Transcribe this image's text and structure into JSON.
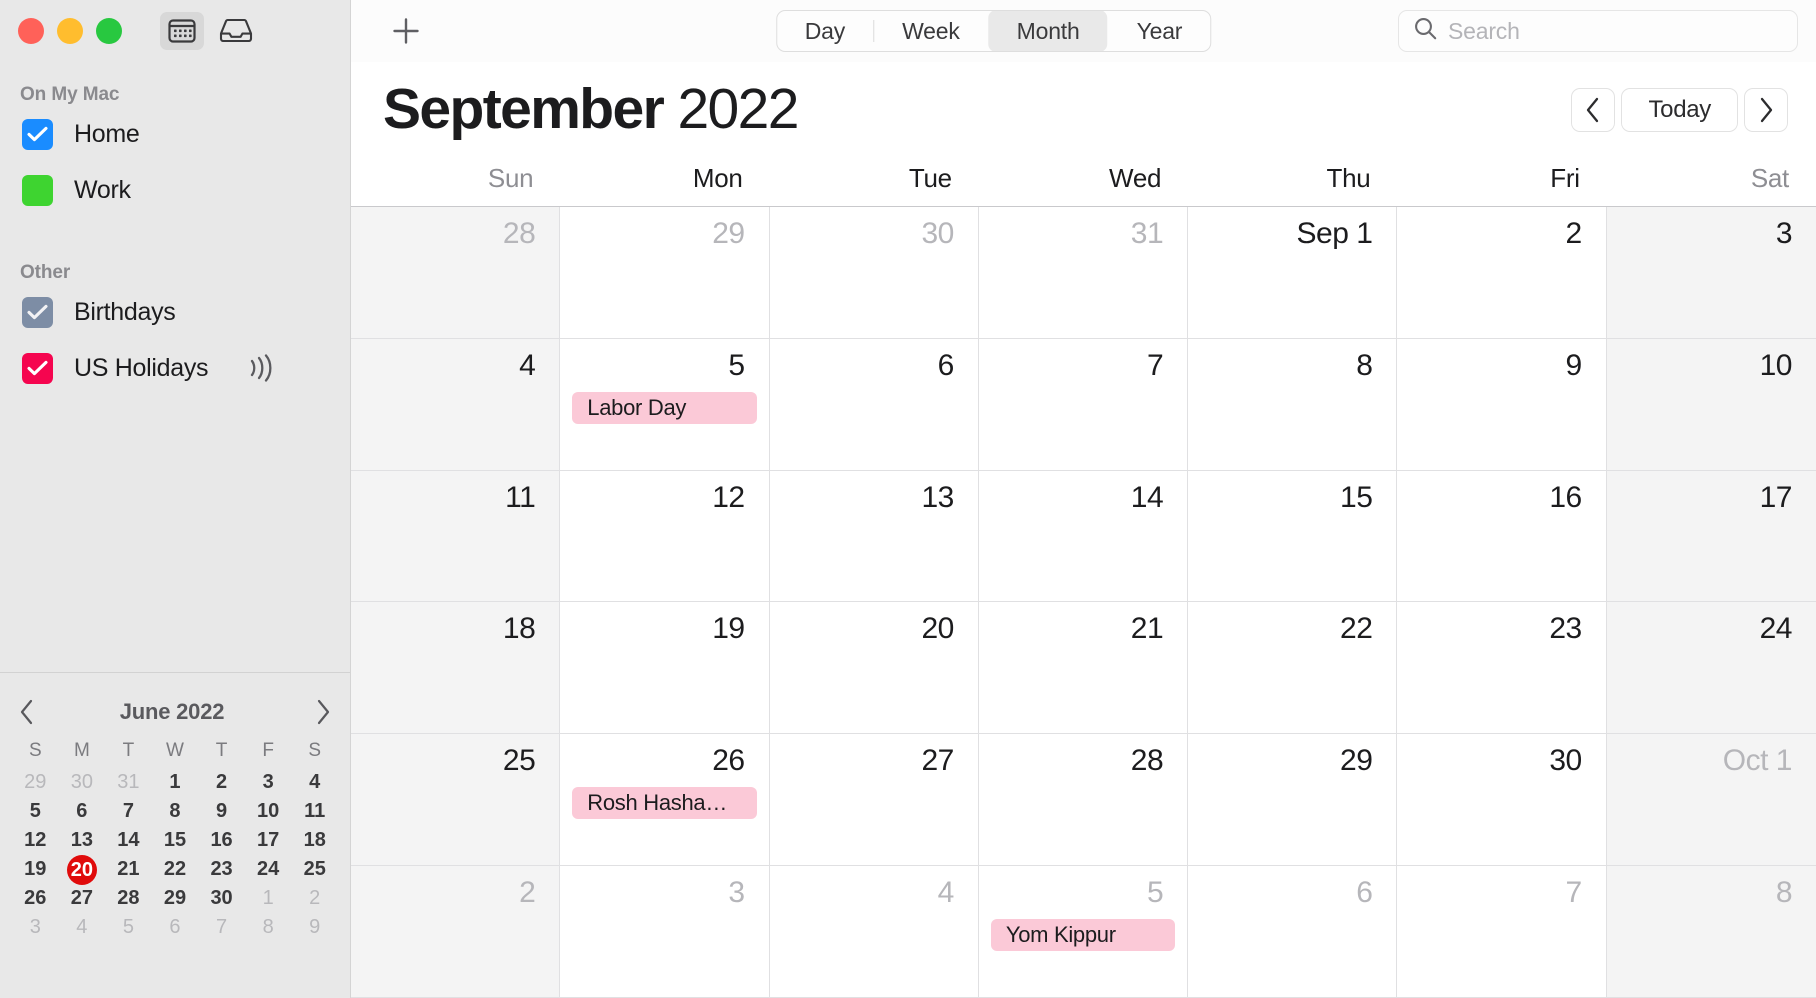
{
  "window": {
    "traffic_lights": [
      "close",
      "minimize",
      "zoom"
    ],
    "toolbar_icons": [
      {
        "name": "calendar-view-icon",
        "active": true
      },
      {
        "name": "inbox-icon",
        "active": false
      }
    ]
  },
  "sidebar": {
    "sections": [
      {
        "title": "On My Mac",
        "items": [
          {
            "label": "Home",
            "color": "#1a8cff",
            "checked": true
          },
          {
            "label": "Work",
            "color": "#3ed430",
            "checked": false
          }
        ]
      },
      {
        "title": "Other",
        "items": [
          {
            "label": "Birthdays",
            "color": "#7d8da5",
            "checked": true
          },
          {
            "label": "US Holidays",
            "color": "#f5054f",
            "checked": true,
            "badge": "broadcast-icon"
          }
        ]
      }
    ],
    "mini_calendar": {
      "title": "June 2022",
      "prev_label": "‹",
      "next_label": "›",
      "dow": [
        "S",
        "M",
        "T",
        "W",
        "T",
        "F",
        "S"
      ],
      "today": 20,
      "weeks": [
        [
          {
            "d": "29",
            "muted": true
          },
          {
            "d": "30",
            "muted": true
          },
          {
            "d": "31",
            "muted": true
          },
          {
            "d": "1"
          },
          {
            "d": "2"
          },
          {
            "d": "3"
          },
          {
            "d": "4"
          }
        ],
        [
          {
            "d": "5"
          },
          {
            "d": "6"
          },
          {
            "d": "7"
          },
          {
            "d": "8"
          },
          {
            "d": "9"
          },
          {
            "d": "10"
          },
          {
            "d": "11"
          }
        ],
        [
          {
            "d": "12"
          },
          {
            "d": "13"
          },
          {
            "d": "14"
          },
          {
            "d": "15"
          },
          {
            "d": "16"
          },
          {
            "d": "17"
          },
          {
            "d": "18"
          }
        ],
        [
          {
            "d": "19"
          },
          {
            "d": "20",
            "today": true
          },
          {
            "d": "21"
          },
          {
            "d": "22"
          },
          {
            "d": "23"
          },
          {
            "d": "24"
          },
          {
            "d": "25"
          }
        ],
        [
          {
            "d": "26"
          },
          {
            "d": "27"
          },
          {
            "d": "28"
          },
          {
            "d": "29"
          },
          {
            "d": "30"
          },
          {
            "d": "1",
            "muted": true
          },
          {
            "d": "2",
            "muted": true
          }
        ],
        [
          {
            "d": "3",
            "muted": true
          },
          {
            "d": "4",
            "muted": true
          },
          {
            "d": "5",
            "muted": true
          },
          {
            "d": "6",
            "muted": true
          },
          {
            "d": "7",
            "muted": true
          },
          {
            "d": "8",
            "muted": true
          },
          {
            "d": "9",
            "muted": true
          }
        ]
      ]
    }
  },
  "toolbar": {
    "add_label": "+",
    "views": [
      {
        "label": "Day",
        "active": false
      },
      {
        "label": "Week",
        "active": false
      },
      {
        "label": "Month",
        "active": true
      },
      {
        "label": "Year",
        "active": false
      }
    ],
    "search": {
      "placeholder": "Search",
      "value": ""
    }
  },
  "header": {
    "month": "September",
    "year": "2022",
    "prev_label": "‹",
    "today_label": "Today",
    "next_label": "›"
  },
  "calendar": {
    "weekday_headers": [
      {
        "label": "Sun",
        "weekend": true
      },
      {
        "label": "Mon",
        "weekend": false
      },
      {
        "label": "Tue",
        "weekend": false
      },
      {
        "label": "Wed",
        "weekend": false
      },
      {
        "label": "Thu",
        "weekend": false
      },
      {
        "label": "Fri",
        "weekend": false
      },
      {
        "label": "Sat",
        "weekend": true
      }
    ],
    "event_color": "#fbc9d7",
    "cells": [
      {
        "day": "28",
        "other": true,
        "weekend": true,
        "events": []
      },
      {
        "day": "29",
        "other": true,
        "weekend": false,
        "events": []
      },
      {
        "day": "30",
        "other": true,
        "weekend": false,
        "events": []
      },
      {
        "day": "31",
        "other": true,
        "weekend": false,
        "events": []
      },
      {
        "day": "Sep 1",
        "other": false,
        "weekend": false,
        "events": []
      },
      {
        "day": "2",
        "other": false,
        "weekend": false,
        "events": []
      },
      {
        "day": "3",
        "other": false,
        "weekend": true,
        "events": []
      },
      {
        "day": "4",
        "other": false,
        "weekend": true,
        "events": []
      },
      {
        "day": "5",
        "other": false,
        "weekend": false,
        "events": [
          {
            "title": "Labor Day"
          }
        ]
      },
      {
        "day": "6",
        "other": false,
        "weekend": false,
        "events": []
      },
      {
        "day": "7",
        "other": false,
        "weekend": false,
        "events": []
      },
      {
        "day": "8",
        "other": false,
        "weekend": false,
        "events": []
      },
      {
        "day": "9",
        "other": false,
        "weekend": false,
        "events": []
      },
      {
        "day": "10",
        "other": false,
        "weekend": true,
        "events": []
      },
      {
        "day": "11",
        "other": false,
        "weekend": true,
        "events": []
      },
      {
        "day": "12",
        "other": false,
        "weekend": false,
        "events": []
      },
      {
        "day": "13",
        "other": false,
        "weekend": false,
        "events": []
      },
      {
        "day": "14",
        "other": false,
        "weekend": false,
        "events": []
      },
      {
        "day": "15",
        "other": false,
        "weekend": false,
        "events": []
      },
      {
        "day": "16",
        "other": false,
        "weekend": false,
        "events": []
      },
      {
        "day": "17",
        "other": false,
        "weekend": true,
        "events": []
      },
      {
        "day": "18",
        "other": false,
        "weekend": true,
        "events": []
      },
      {
        "day": "19",
        "other": false,
        "weekend": false,
        "events": []
      },
      {
        "day": "20",
        "other": false,
        "weekend": false,
        "events": []
      },
      {
        "day": "21",
        "other": false,
        "weekend": false,
        "events": []
      },
      {
        "day": "22",
        "other": false,
        "weekend": false,
        "events": []
      },
      {
        "day": "23",
        "other": false,
        "weekend": false,
        "events": []
      },
      {
        "day": "24",
        "other": false,
        "weekend": true,
        "events": []
      },
      {
        "day": "25",
        "other": false,
        "weekend": true,
        "events": []
      },
      {
        "day": "26",
        "other": false,
        "weekend": false,
        "events": [
          {
            "title": "Rosh Hasha…"
          }
        ]
      },
      {
        "day": "27",
        "other": false,
        "weekend": false,
        "events": []
      },
      {
        "day": "28",
        "other": false,
        "weekend": false,
        "events": []
      },
      {
        "day": "29",
        "other": false,
        "weekend": false,
        "events": []
      },
      {
        "day": "30",
        "other": false,
        "weekend": false,
        "events": []
      },
      {
        "day": "Oct 1",
        "other": true,
        "weekend": true,
        "events": []
      },
      {
        "day": "2",
        "other": true,
        "weekend": true,
        "events": []
      },
      {
        "day": "3",
        "other": true,
        "weekend": false,
        "events": []
      },
      {
        "day": "4",
        "other": true,
        "weekend": false,
        "events": []
      },
      {
        "day": "5",
        "other": true,
        "weekend": false,
        "events": [
          {
            "title": "Yom Kippur"
          }
        ]
      },
      {
        "day": "6",
        "other": true,
        "weekend": false,
        "events": []
      },
      {
        "day": "7",
        "other": true,
        "weekend": false,
        "events": []
      },
      {
        "day": "8",
        "other": true,
        "weekend": true,
        "events": []
      }
    ]
  }
}
